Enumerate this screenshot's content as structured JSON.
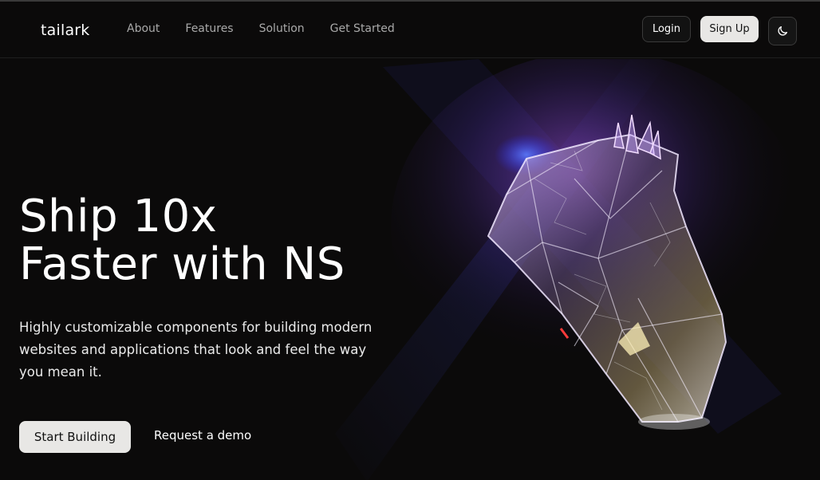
{
  "header": {
    "logo_text": "tailark",
    "nav": [
      {
        "label": "About"
      },
      {
        "label": "Features"
      },
      {
        "label": "Solution"
      },
      {
        "label": "Get Started"
      }
    ],
    "login_label": "Login",
    "signup_label": "Sign Up",
    "theme_icon": "moon-icon"
  },
  "hero": {
    "title_line1": "Ship 10x",
    "title_line2": "Faster with NS",
    "subtitle": "Highly customizable components for building modern websites and applications that look and feel the way you mean it.",
    "primary_cta": "Start Building",
    "secondary_cta": "Request a demo"
  },
  "colors": {
    "background": "#0b0a0a",
    "logo_accent": "#7fb0e6",
    "button_light": "#e8e7e5"
  }
}
